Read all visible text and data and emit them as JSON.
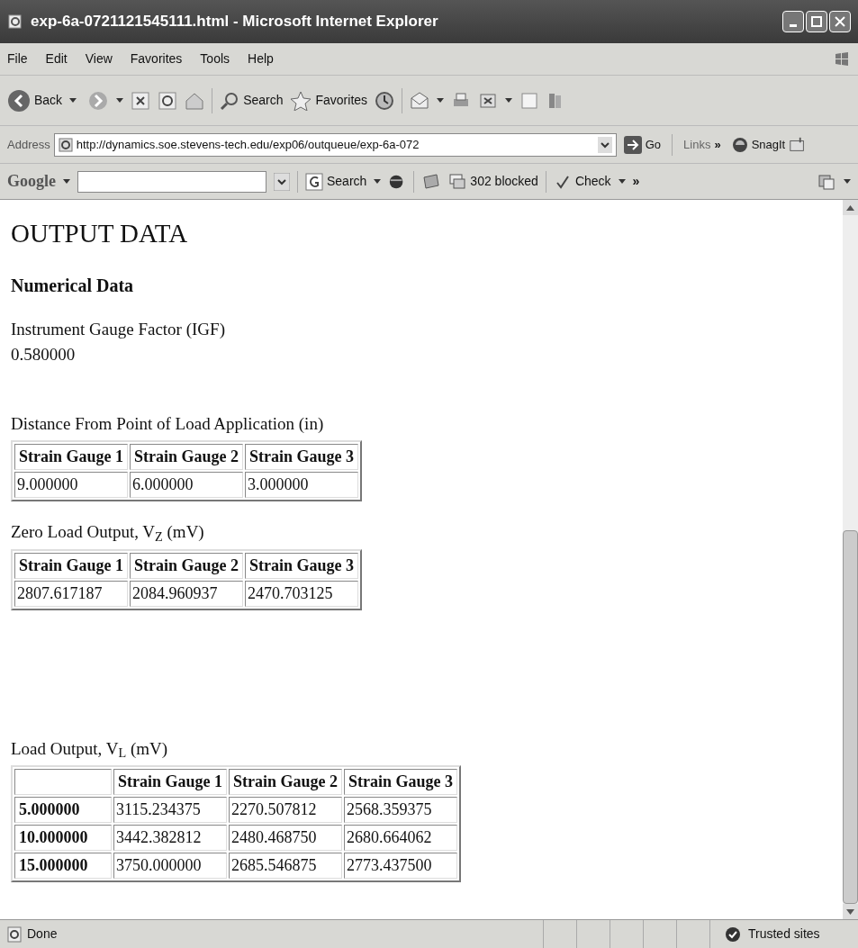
{
  "window": {
    "title": "exp-6a-0721121545111.html - Microsoft Internet Explorer"
  },
  "menu": [
    "File",
    "Edit",
    "View",
    "Favorites",
    "Tools",
    "Help"
  ],
  "toolbar": {
    "back": "Back",
    "search": "Search",
    "favorites": "Favorites"
  },
  "address_bar": {
    "label": "Address",
    "url": "http://dynamics.soe.stevens-tech.edu/exp06/outqueue/exp-6a-072",
    "go": "Go",
    "links": "Links",
    "more": "»",
    "snagit": "SnagIt"
  },
  "google_bar": {
    "logo": "Google",
    "search": "Search",
    "blocked": "302 blocked",
    "check": "Check",
    "more": "»"
  },
  "page": {
    "heading": "OUTPUT DATA",
    "subheading": "Numerical Data",
    "igf_label": "Instrument Gauge Factor (IGF)",
    "igf_value": "0.580000",
    "tables": [
      {
        "caption": "Distance From Point of Load Application (in)",
        "corner": false,
        "columns": [
          "Strain Gauge 1",
          "Strain Gauge 2",
          "Strain Gauge 3"
        ],
        "rows": [
          {
            "cells": [
              "9.000000",
              "6.000000",
              "3.000000"
            ]
          }
        ]
      },
      {
        "caption": "Zero Load Output, V$_{Z}$ (mV)",
        "corner": false,
        "columns": [
          "Strain Gauge 1",
          "Strain Gauge 2",
          "Strain Gauge 3"
        ],
        "rows": [
          {
            "cells": [
              "2807.617187",
              "2084.960937",
              "2470.703125"
            ]
          }
        ]
      },
      {
        "caption": "Load Output, V$_{L}$ (mV)",
        "corner": true,
        "columns": [
          "Strain Gauge 1",
          "Strain Gauge 2",
          "Strain Gauge 3"
        ],
        "rows": [
          {
            "head": "5.000000",
            "cells": [
              "3115.234375",
              "2270.507812",
              "2568.359375"
            ]
          },
          {
            "head": "10.000000",
            "cells": [
              "3442.382812",
              "2480.468750",
              "2680.664062"
            ]
          },
          {
            "head": "15.000000",
            "cells": [
              "3750.000000",
              "2685.546875",
              "2773.437500"
            ]
          }
        ]
      }
    ]
  },
  "status_bar": {
    "text": "Done",
    "zone": "Trusted sites"
  }
}
